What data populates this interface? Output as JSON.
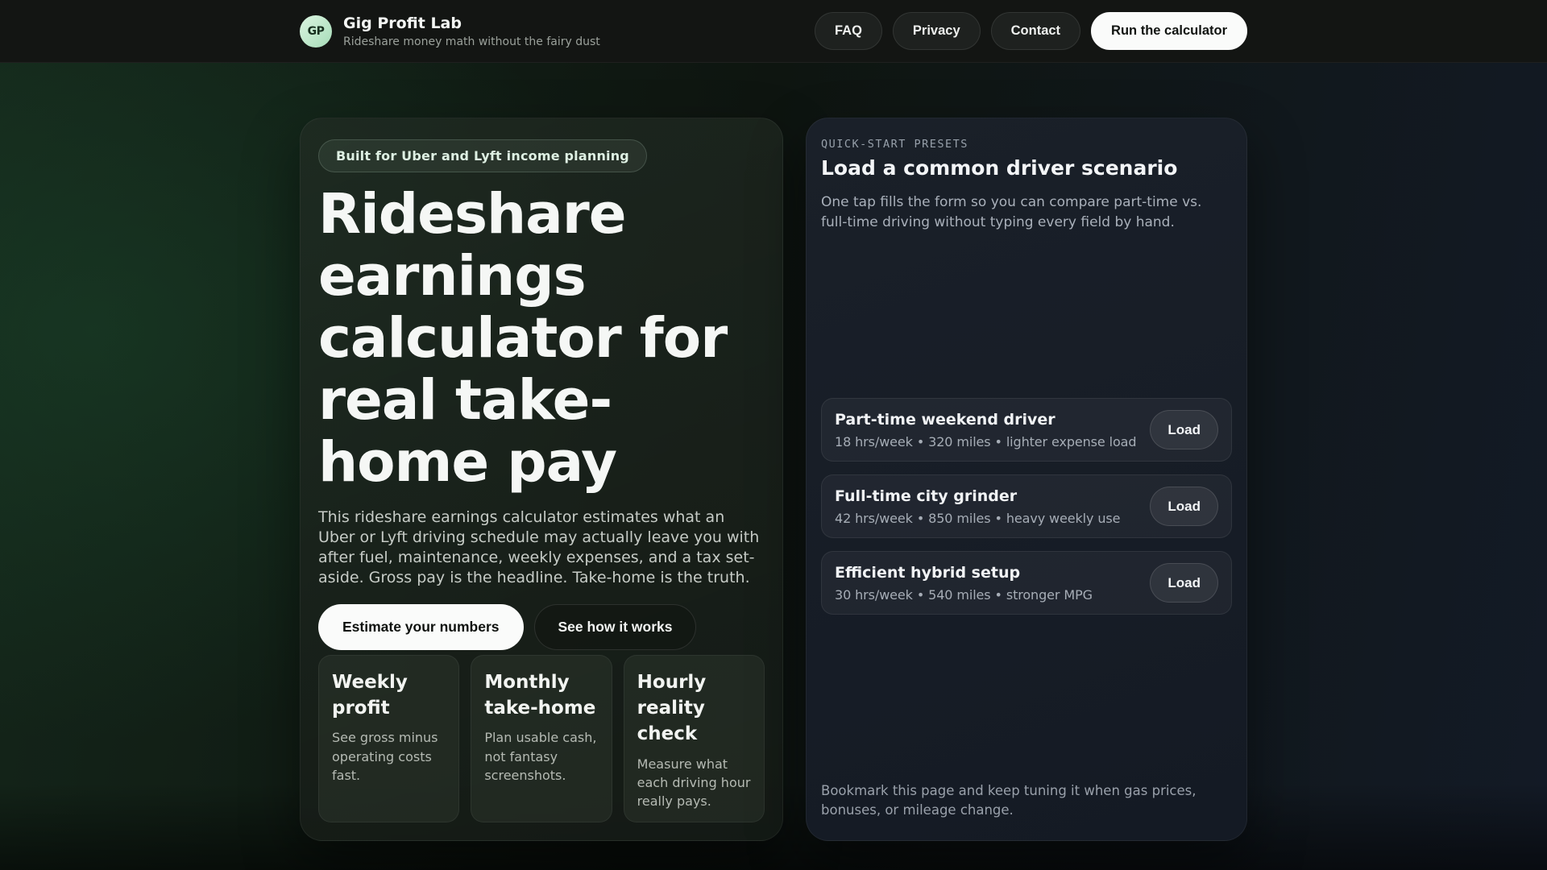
{
  "header": {
    "logo_initials": "GP",
    "brand_name": "Gig Profit Lab",
    "tagline": "Rideshare money math without the fairy dust",
    "nav": [
      {
        "label": "FAQ"
      },
      {
        "label": "Privacy"
      },
      {
        "label": "Contact"
      }
    ],
    "cta_label": "Run the calculator"
  },
  "hero": {
    "badge": "Built for Uber and Lyft income planning",
    "title": "Rideshare earnings calculator for real take-home pay",
    "description": "This rideshare earnings calculator estimates what an Uber or Lyft driving schedule may actually leave you with after fuel, maintenance, weekly expenses, and a tax set-aside. Gross pay is the headline. Take-home is the truth.",
    "primary_cta": "Estimate your numbers",
    "secondary_cta": "See how it works",
    "features": [
      {
        "title": "Weekly profit",
        "description": "See gross minus operating costs fast."
      },
      {
        "title": "Monthly take-home",
        "description": "Plan usable cash, not fantasy screenshots."
      },
      {
        "title": "Hourly reality check",
        "description": "Measure what each driving hour really pays."
      }
    ]
  },
  "presets": {
    "eyebrow": "QUICK-START PRESETS",
    "title": "Load a common driver scenario",
    "description": "One tap fills the form so you can compare part-time vs. full-time driving without typing every field by hand.",
    "items": [
      {
        "title": "Part-time weekend driver",
        "meta": "18 hrs/week • 320 miles • lighter expense load",
        "button": "Load"
      },
      {
        "title": "Full-time city grinder",
        "meta": "42 hrs/week • 850 miles • heavy weekly use",
        "button": "Load"
      },
      {
        "title": "Efficient hybrid setup",
        "meta": "30 hrs/week • 540 miles • stronger MPG",
        "button": "Load"
      }
    ],
    "note": "Bookmark this page and keep tuning it when gas prices, bonuses, or mileage change."
  },
  "colors": {
    "accent_mint": "#b9e4c6",
    "cta_white": "#fafbfa",
    "page_green": "#14261a",
    "panel_blue": "#171c25"
  }
}
